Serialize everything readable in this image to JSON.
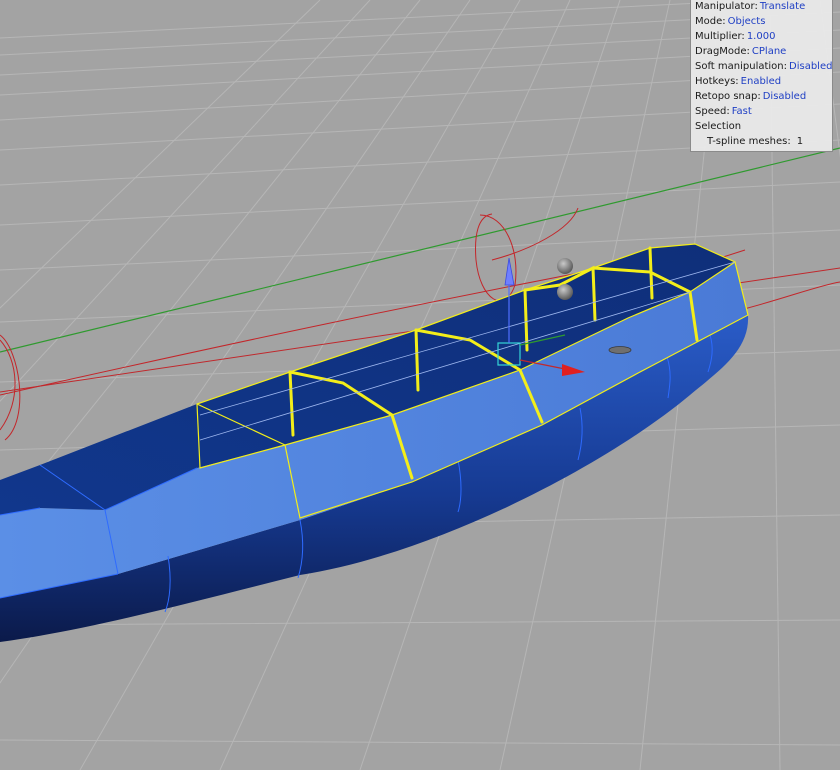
{
  "info_panel": {
    "rows": [
      {
        "label": "Manipulator:",
        "value": "Translate"
      },
      {
        "label": "Mode:",
        "value": "Objects"
      },
      {
        "label": "Multiplier:",
        "value": "1.000"
      },
      {
        "label": "DragMode:",
        "value": "CPlane"
      },
      {
        "label": "Soft manipulation:",
        "value": "Disabled"
      },
      {
        "label": "Hotkeys:",
        "value": "Enabled"
      },
      {
        "label": "Retopo snap:",
        "value": "Disabled"
      },
      {
        "label": "Speed:",
        "value": "Fast"
      }
    ],
    "selection_label": "Selection",
    "tspline_label": "T-spline meshes:",
    "tspline_count": "1",
    "value_color": "#1f3fc4"
  },
  "viewport": {
    "background": "#a3a3a3",
    "grid_color": "#b4b4b4",
    "x_axis_color": "#c0282c",
    "y_axis_color": "#2f9a2f",
    "mesh_color": "#1f4fc0",
    "selection_color": "#f3ee1a"
  }
}
